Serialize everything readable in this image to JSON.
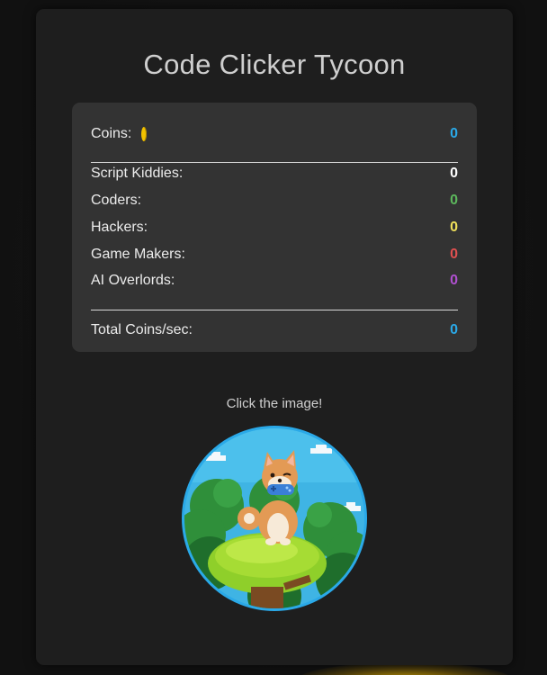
{
  "title": "Code Clicker Tycoon",
  "stats": {
    "coins": {
      "label": "Coins:",
      "value": "0",
      "color": "#2aa9e8"
    },
    "producers": [
      {
        "label": "Script Kiddies:",
        "value": "0",
        "color": "#ffffff"
      },
      {
        "label": "Coders:",
        "value": "0",
        "color": "#5cb85c"
      },
      {
        "label": "Hackers:",
        "value": "0",
        "color": "#f0e05a"
      },
      {
        "label": "Game Makers:",
        "value": "0",
        "color": "#e05050"
      },
      {
        "label": "AI Overlords:",
        "value": "0",
        "color": "#b050d0"
      }
    ],
    "total": {
      "label": "Total Coins/sec:",
      "value": "0",
      "color": "#2aa9e8"
    }
  },
  "clicker": {
    "hint": "Click the image!",
    "image_subject": "shiba-dog-with-gamepad-on-tree",
    "border_color": "#2aa9e8"
  }
}
